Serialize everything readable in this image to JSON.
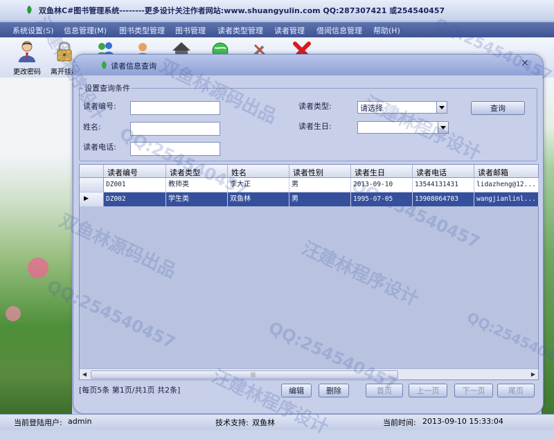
{
  "app": {
    "title": "双鱼林C#图书管理系统--------更多设计关注作者网站:www.shuangyulin.com   QQ:287307421 或254540457"
  },
  "menu": [
    "系统设置(S)",
    "信息管理(M)",
    "图书类型管理",
    "图书管理",
    "读者类型管理",
    "读者管理",
    "借阅信息管理",
    "帮助(H)"
  ],
  "toolbar": {
    "change_password": "更改密码",
    "leave_system": "离开挂起"
  },
  "child_window": {
    "title": "读者信息查询",
    "close_glyph": "×"
  },
  "query": {
    "legend": "设置查询条件",
    "reader_no_label": "读者编号:",
    "name_label": "姓名:",
    "phone_label": "读者电话:",
    "reader_type_label": "读者类型:",
    "reader_type_value": "请选择",
    "birthday_label": "读者生日:",
    "search_button": "查询"
  },
  "grid": {
    "columns": [
      "读者编号",
      "读者类型",
      "姓名",
      "读者性别",
      "读者生日",
      "读者电话",
      "读者邮箱"
    ],
    "rows": [
      [
        "DZ001",
        "教师类",
        "李大正",
        "男",
        "2013-09-10",
        "13544131431",
        "lidazheng@12..."
      ],
      [
        "DZ002",
        "学生类",
        "双鱼林",
        "男",
        "1995-07-05",
        "13908064703",
        "wangjianlinl..."
      ]
    ],
    "selected_row_marker": "▶"
  },
  "pager": {
    "info": "[每页5条  第1页/共1页    共2条]",
    "edit": "编辑",
    "delete": "删除",
    "first": "首页",
    "prev": "上一页",
    "next": "下一页",
    "last": "尾页"
  },
  "status": {
    "user_label": "当前登陆用户:",
    "user_value": "admin",
    "support_label": "技术支持:",
    "support_value": "双鱼林",
    "time_label": "当前时间:",
    "time_value": "2013-09-10 15:33:04"
  },
  "watermarks": [
    "双鱼林源码出品",
    "汪建林程序设计",
    "QQ:254540457"
  ],
  "colors": {
    "menubar": "#4a5e9c",
    "selected_row": "#344f9c",
    "window_body": "#c7cfe9"
  }
}
